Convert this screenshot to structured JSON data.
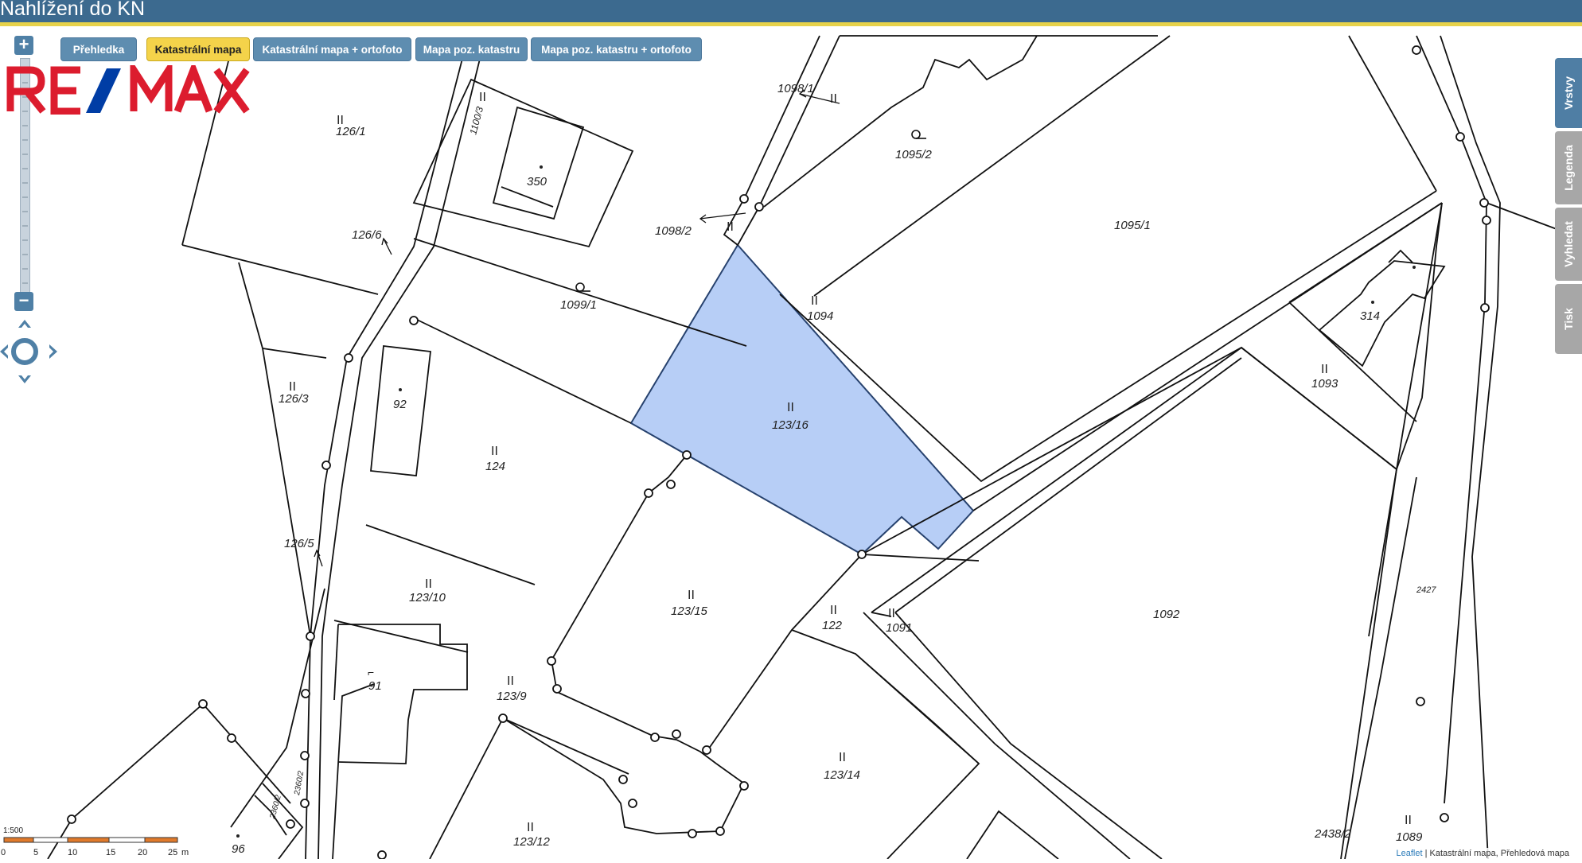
{
  "window": {
    "title": "Nahlížení do KN"
  },
  "toolbar": {
    "tabs": [
      {
        "label": "Přehledka",
        "active": false
      },
      {
        "label": "Katastrální mapa",
        "active": true
      },
      {
        "label": "Katastrální mapa + ortofoto",
        "active": false
      },
      {
        "label": "Mapa poz. katastru",
        "active": false
      },
      {
        "label": "Mapa poz. katastru + ortofoto",
        "active": false
      }
    ]
  },
  "logo": {
    "text": "RE/MAX",
    "colors": {
      "primary": "#dc1c2e",
      "secondary": "#003da5"
    }
  },
  "zoom": {
    "in_label": "+",
    "out_label": "−"
  },
  "side_panel": {
    "tabs": [
      {
        "label": "Vrstvy",
        "active": true
      },
      {
        "label": "Legenda",
        "active": false
      },
      {
        "label": "Vyhledat",
        "active": false
      },
      {
        "label": "Tisk",
        "active": false
      }
    ]
  },
  "map": {
    "selected_parcel": "123/16",
    "colors": {
      "selection_fill": "#b7cef6",
      "selection_stroke": "#27426e",
      "line": "#111111"
    },
    "parcels": [
      "126/1",
      "126/6",
      "126/3",
      "126/5",
      "350",
      "1100/3",
      "1099/1",
      "1098/2",
      "1098/1",
      "1095/2",
      "1095/1",
      "1094",
      "123/16",
      "92",
      "124",
      "123/10",
      "91",
      "123/9",
      "123/15",
      "122",
      "1091",
      "1092",
      "314",
      "1093",
      "2427",
      "123/14",
      "123/12",
      "96",
      "2438/2",
      "1089",
      "2360/2",
      "2360/2"
    ]
  },
  "scale": {
    "ratio": "1:500",
    "ticks": [
      "0",
      "5",
      "10",
      "15",
      "20",
      "25"
    ],
    "unit": "m"
  },
  "attribution": {
    "leaflet": "Leaflet",
    "separator": " | ",
    "rest": "Katastrální mapa, Přehledová mapa"
  }
}
